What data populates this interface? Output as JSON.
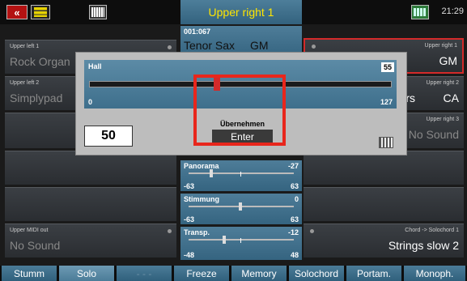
{
  "topbar": {
    "close_label": "«",
    "title": "Upper right 1",
    "time": "21:29"
  },
  "left_panels": [
    {
      "small": "Upper left 1",
      "big": "Rock Organ"
    },
    {
      "small": "Upper left 2",
      "big": "Simplypad"
    },
    {
      "small": "",
      "big": ""
    },
    {
      "small": "",
      "big": ""
    },
    {
      "small": "",
      "big": ""
    },
    {
      "small": "Upper MIDI out",
      "big": "No Sound"
    }
  ],
  "right_panels": [
    {
      "small": "Upper right 1",
      "big": "GM"
    },
    {
      "small": "Upper right 2",
      "big": "CA",
      "partial": "rs"
    },
    {
      "small": "Upper right 3",
      "big": "No Sound"
    },
    {
      "small": "",
      "big": ""
    },
    {
      "small": "",
      "big": ""
    },
    {
      "small": "Chord ->     Solochord 1",
      "big": "Strings  slow  2"
    }
  ],
  "center": {
    "voice_number": "001:067",
    "voice_name": "Tenor Sax",
    "voice_bank": "GM",
    "sliders": [
      {
        "name": "Panorama",
        "value": "-27",
        "min": "-63",
        "max": "63"
      },
      {
        "name": "Stimmung",
        "value": "0",
        "min": "-63",
        "max": "63"
      },
      {
        "name": "Transp.",
        "value": "-12",
        "min": "-48",
        "max": "48"
      }
    ]
  },
  "dialog": {
    "title": "Hall",
    "value": "55",
    "min": "0",
    "max": "127",
    "input_value": "50",
    "apply_label": "Übernehmen",
    "enter_label": "Enter"
  },
  "bottom_buttons": [
    {
      "label": "Stumm"
    },
    {
      "label": "Solo"
    },
    {
      "label": "- - -"
    },
    {
      "label": "Freeze"
    },
    {
      "label": "Memory"
    },
    {
      "label": "Solochord"
    },
    {
      "label": "Portam."
    },
    {
      "label": "Monoph."
    }
  ]
}
